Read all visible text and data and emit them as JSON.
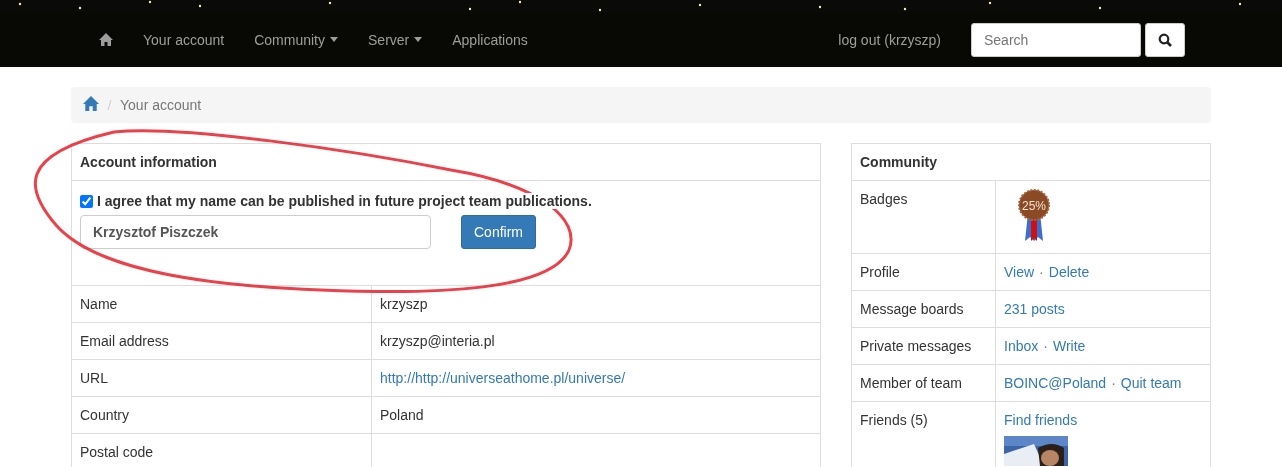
{
  "navbar": {
    "items": [
      {
        "kind": "home"
      },
      {
        "kind": "link",
        "label": "Your account"
      },
      {
        "kind": "dropdown",
        "label": "Community"
      },
      {
        "kind": "dropdown",
        "label": "Server"
      },
      {
        "kind": "link",
        "label": "Applications"
      }
    ],
    "logout": "log out (krzyszp)",
    "search": {
      "placeholder": "Search"
    }
  },
  "breadcrumb": {
    "current": "Your account"
  },
  "account": {
    "title": "Account information",
    "consent": {
      "checked": true,
      "label": "I agree that my name can be published in future project team publications."
    },
    "name_field": {
      "value": "Krzysztof Piszczek"
    },
    "confirm": "Confirm",
    "rows": [
      {
        "label": "Name",
        "value": "krzyszp",
        "kind": "text"
      },
      {
        "label": "Email address",
        "value": "krzyszp@interia.pl",
        "kind": "text"
      },
      {
        "label": "URL",
        "value": "http://http://universeathome.pl/universe/",
        "kind": "link"
      },
      {
        "label": "Country",
        "value": "Poland",
        "kind": "text"
      },
      {
        "label": "Postal code",
        "kind": "text"
      }
    ]
  },
  "community": {
    "title": "Community",
    "separator": "·",
    "rows": [
      {
        "label": "Badges",
        "kind": "badge",
        "badge": "25%"
      },
      {
        "label": "Profile",
        "kind": "links",
        "links": [
          "View",
          "Delete"
        ]
      },
      {
        "label": "Message boards",
        "kind": "links",
        "links": [
          "231 posts"
        ]
      },
      {
        "label": "Private messages",
        "kind": "links",
        "links": [
          "Inbox",
          "Write"
        ]
      },
      {
        "label": "Member of team",
        "kind": "links",
        "links": [
          "BOINC@Poland",
          "Quit team"
        ]
      },
      {
        "label": "Friends (5)",
        "kind": "friends",
        "links": [
          "Find friends"
        ]
      }
    ]
  }
}
